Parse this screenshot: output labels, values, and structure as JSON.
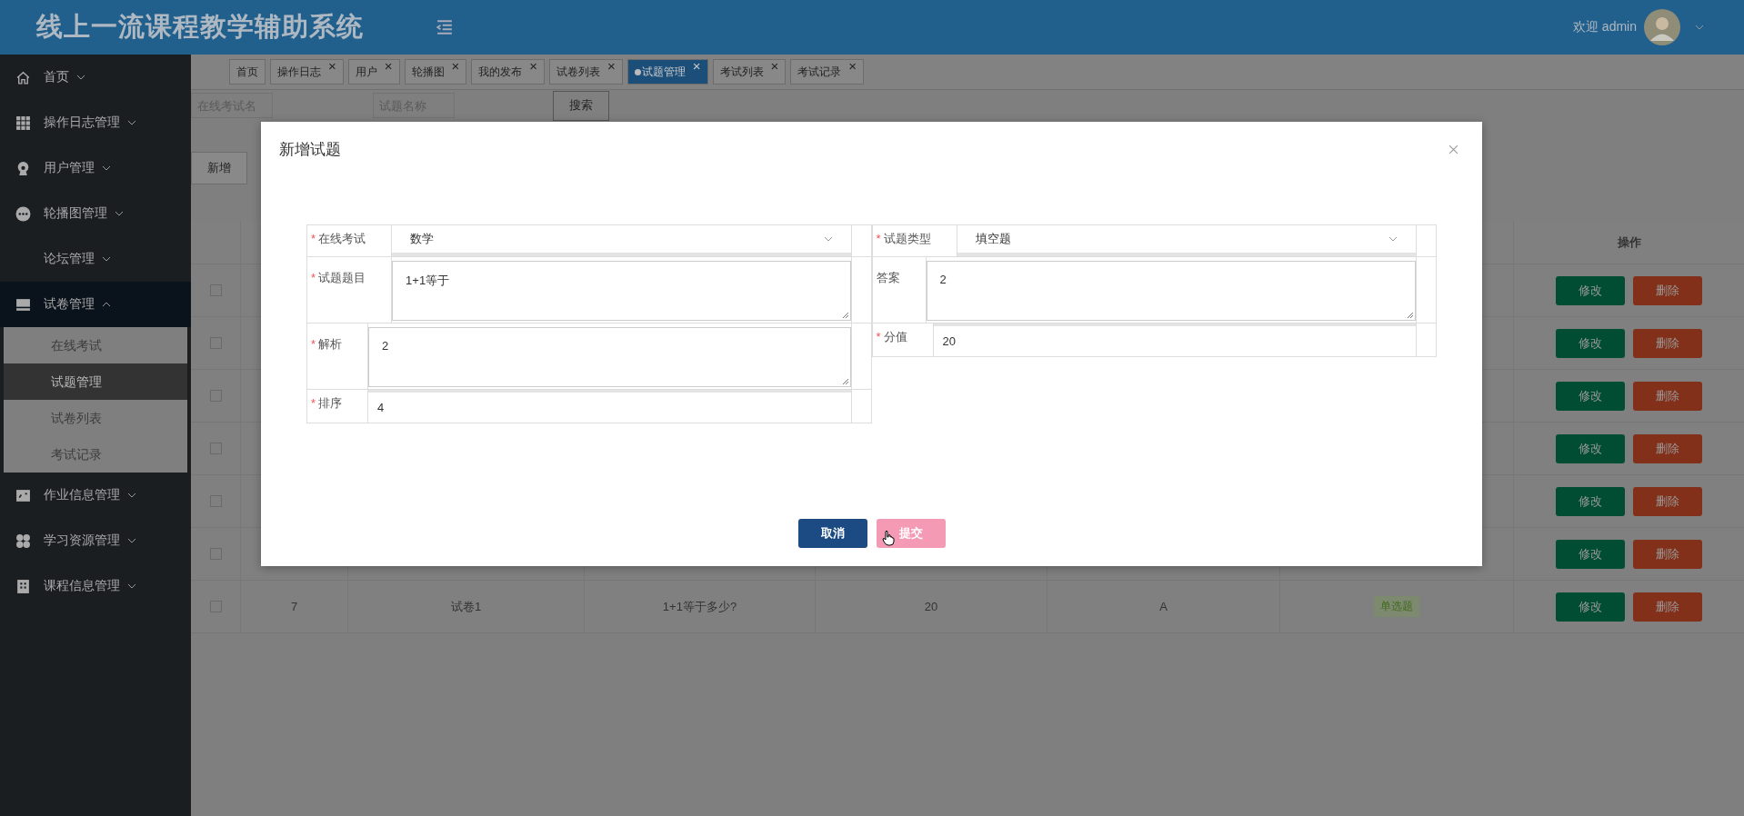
{
  "header": {
    "title": "线上一流课程教学辅助系统",
    "welcome": "欢迎 admin"
  },
  "sidebar": {
    "items": [
      {
        "label": "首页",
        "expanded": false,
        "selected": false
      },
      {
        "label": "操作日志管理",
        "expanded": false,
        "selected": false
      },
      {
        "label": "用户管理",
        "expanded": false,
        "selected": false
      },
      {
        "label": "轮播图管理",
        "expanded": false,
        "selected": false
      },
      {
        "label": "论坛管理",
        "expanded": false,
        "selected": false
      },
      {
        "label": "试卷管理",
        "expanded": true,
        "selected": true,
        "children": [
          {
            "label": "在线考试",
            "selected": false
          },
          {
            "label": "试题管理",
            "selected": true
          },
          {
            "label": "试卷列表",
            "selected": false
          },
          {
            "label": "考试记录",
            "selected": false
          }
        ]
      },
      {
        "label": "作业信息管理",
        "expanded": false,
        "selected": false
      },
      {
        "label": "学习资源管理",
        "expanded": false,
        "selected": false
      },
      {
        "label": "课程信息管理",
        "expanded": false,
        "selected": false
      }
    ]
  },
  "tabs": [
    {
      "label": "首页",
      "closable": false,
      "selected": false
    },
    {
      "label": "操作日志",
      "closable": true,
      "selected": false
    },
    {
      "label": "用户",
      "closable": true,
      "selected": false
    },
    {
      "label": "轮播图",
      "closable": true,
      "selected": false
    },
    {
      "label": "我的发布",
      "closable": true,
      "selected": false
    },
    {
      "label": "试卷列表",
      "closable": true,
      "selected": false
    },
    {
      "label": "试题管理",
      "closable": true,
      "selected": true
    },
    {
      "label": "考试列表",
      "closable": true,
      "selected": false
    },
    {
      "label": "考试记录",
      "closable": true,
      "selected": false
    }
  ],
  "tab_close": "×",
  "search": {
    "fields": [
      {
        "placeholder": "在线考试名"
      },
      {
        "placeholder": "试题名称"
      }
    ],
    "button": "搜索"
  },
  "add_button": "新增",
  "table": {
    "action_header": "操作",
    "rows": [
      {
        "checked": false,
        "edit": "修改",
        "delete": "删除"
      },
      {
        "checked": false,
        "edit": "修改",
        "delete": "删除"
      },
      {
        "checked": false,
        "edit": "修改",
        "delete": "删除"
      },
      {
        "checked": false,
        "edit": "修改",
        "delete": "删除"
      },
      {
        "checked": false,
        "edit": "修改",
        "delete": "删除"
      },
      {
        "checked": false,
        "edit": "修改",
        "delete": "删除"
      },
      {
        "checked": false,
        "cells": [
          "7",
          "试卷1",
          "1+1等于多少?",
          "20",
          "A"
        ],
        "tag": "单选题",
        "edit": "修改",
        "delete": "删除"
      }
    ]
  },
  "dialog": {
    "title": "新增试题",
    "required_mark": "*",
    "left": [
      {
        "label": "在线考试",
        "required": true,
        "kind": "select",
        "value": "数学"
      },
      {
        "label": "试题题目",
        "required": true,
        "kind": "textarea",
        "value": "1+1等于"
      },
      {
        "label": "解析",
        "required": true,
        "kind": "textarea",
        "value": "2"
      },
      {
        "label": "排序",
        "required": true,
        "kind": "input",
        "value": "4"
      }
    ],
    "right": [
      {
        "label": "试题类型",
        "required": true,
        "kind": "select",
        "value": "填空题"
      },
      {
        "label": "答案",
        "required": false,
        "kind": "textarea",
        "value": "2"
      },
      {
        "label": "分值",
        "required": true,
        "kind": "input",
        "value": "20"
      }
    ],
    "buttons": [
      {
        "label": "取消",
        "kind": "cancel"
      },
      {
        "label": "提交",
        "kind": "submit"
      }
    ]
  }
}
